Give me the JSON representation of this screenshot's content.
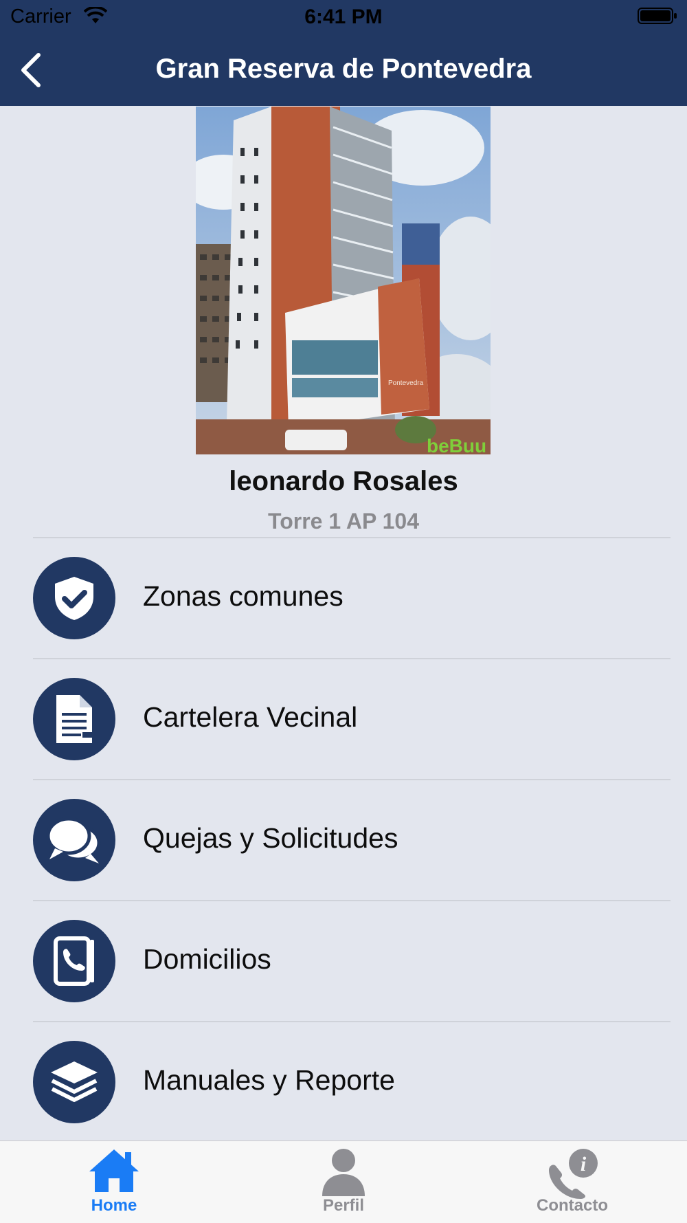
{
  "status_bar": {
    "carrier": "Carrier",
    "time": "6:41 PM"
  },
  "nav": {
    "title": "Gran Reserva de Pontevedra",
    "back_icon": "chevron-left-icon"
  },
  "profile": {
    "name": "leonardo Rosales",
    "unit": "Torre 1 AP 104",
    "image_sign": "Pontevedra",
    "watermark": "beBuu"
  },
  "menu": {
    "items": [
      {
        "label": "Zonas comunes",
        "icon": "shield-check-icon"
      },
      {
        "label": "Cartelera Vecinal",
        "icon": "document-icon"
      },
      {
        "label": " Quejas y Solicitudes",
        "icon": "chat-bubbles-icon"
      },
      {
        "label": "Domicilios",
        "icon": "phone-book-icon"
      },
      {
        "label": "Manuales y Reporte",
        "icon": "layers-icon"
      }
    ]
  },
  "tabs": {
    "items": [
      {
        "label": "Home",
        "icon": "home-icon",
        "active": true
      },
      {
        "label": "Perfil",
        "icon": "person-icon",
        "active": false
      },
      {
        "label": "Contacto",
        "icon": "phone-info-icon",
        "active": false
      }
    ]
  },
  "colors": {
    "primary": "#213863",
    "background": "#e3e6ee",
    "tab_active": "#1a7cf5",
    "tab_inactive": "#8e8e93"
  }
}
